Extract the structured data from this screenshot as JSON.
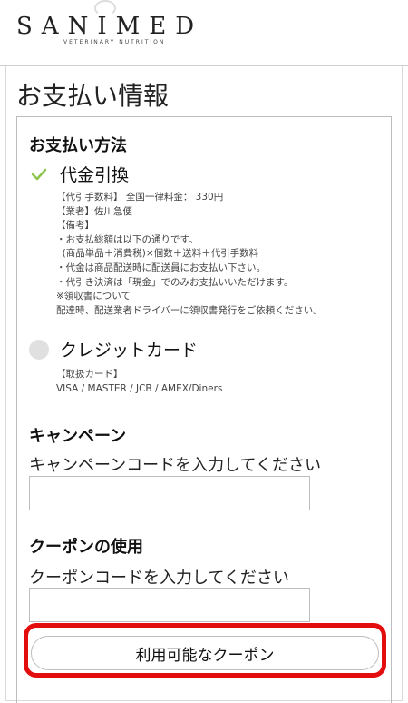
{
  "brand": {
    "name": "SANIMED",
    "tagline": "VETERINARY NUTRITION"
  },
  "page": {
    "title": "お支払い情報"
  },
  "payment": {
    "section_title": "お支払い方法",
    "options": [
      {
        "label": "代金引換",
        "selected": true,
        "note": "【代引手数料】 全国一律料金： 330円\n【業者】佐川急便\n【備考】\n・お支払総額は以下の通りです。\n  (商品単品＋消費税)×個数＋送料＋代引手数料\n・代金は商品配送時に配送員にお支払い下さい。\n・代引き決済は「現金」でのみお支払いいただけます。\n※領収書について\n配達時、配送業者ドライバーに領収書発行をご依頼ください。"
      },
      {
        "label": "クレジットカード",
        "selected": false,
        "note": "【取扱カード】\nVISA / MASTER / JCB / AMEX/Diners"
      }
    ]
  },
  "campaign": {
    "section_title": "キャンペーン",
    "field_label": "キャンペーンコードを入力してください",
    "value": ""
  },
  "coupon": {
    "section_title": "クーポンの使用",
    "field_label": "クーポンコードを入力してください",
    "value": "",
    "available_button": "利用可能なクーポン"
  },
  "colors": {
    "check": "#8cc34a",
    "highlight": "#e30d0d",
    "border": "#bdbdbd"
  }
}
